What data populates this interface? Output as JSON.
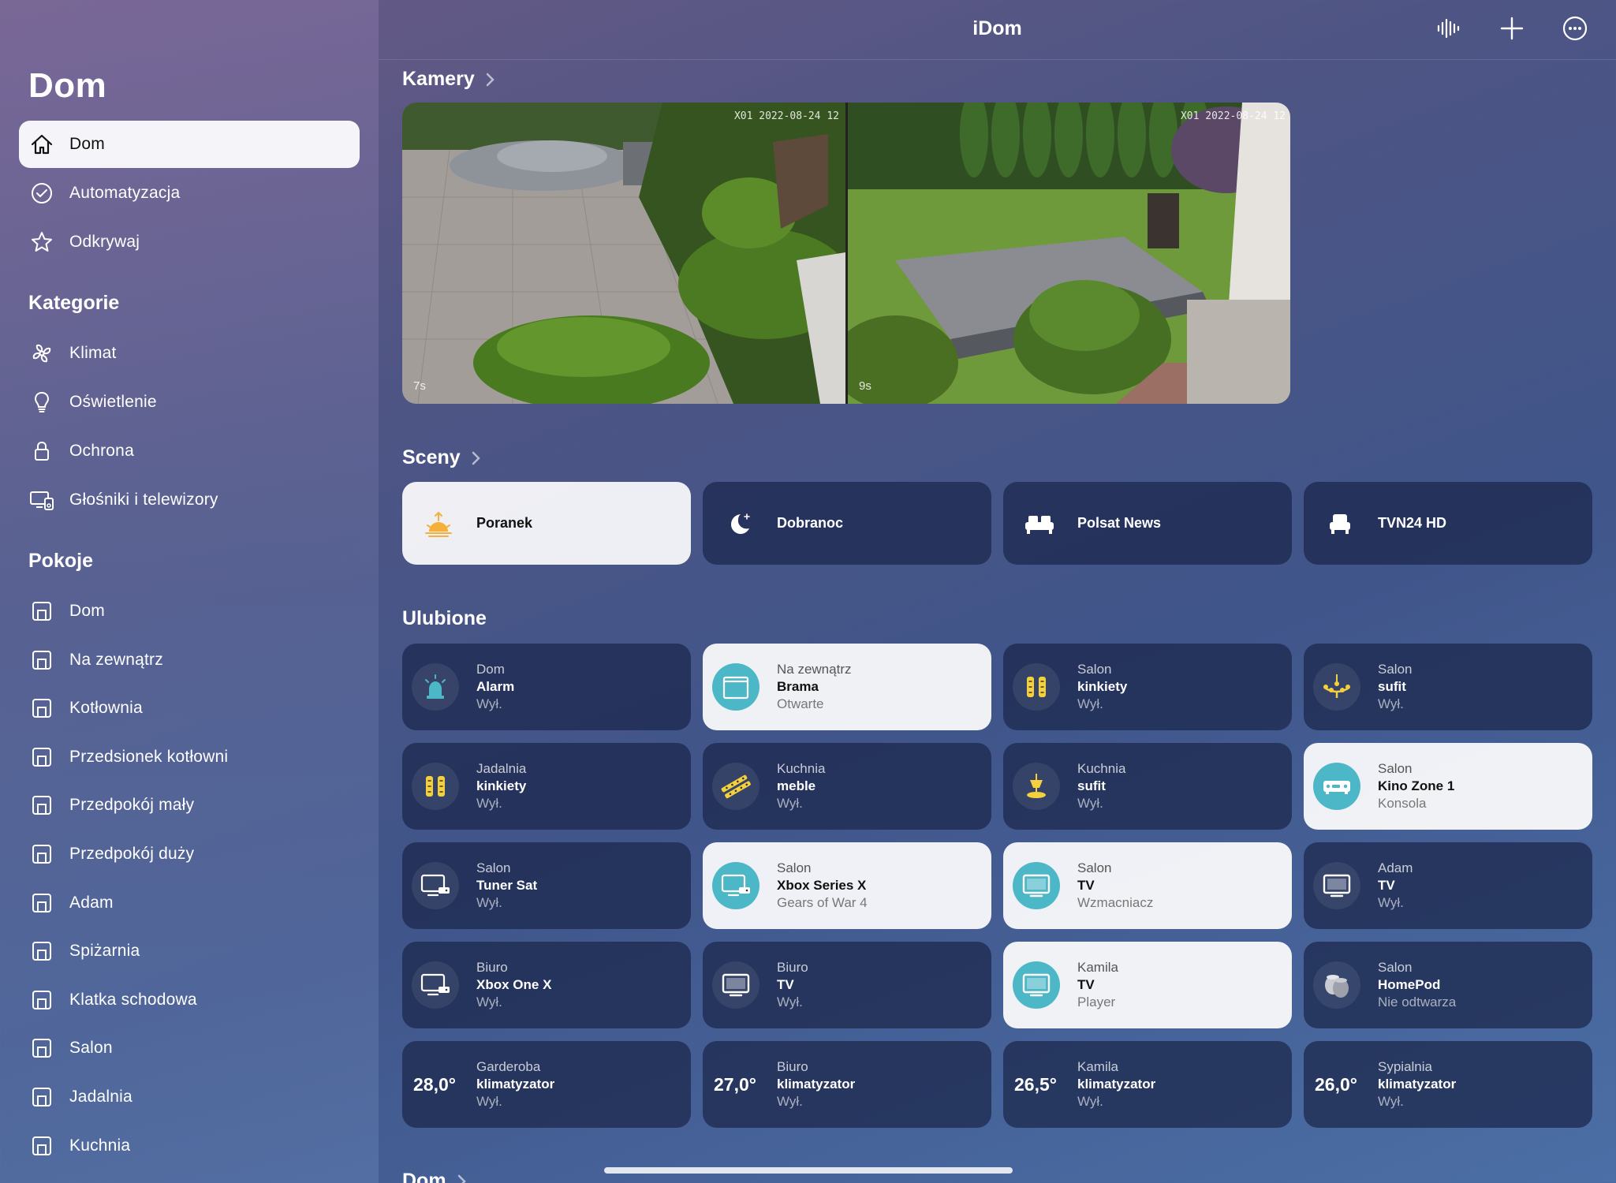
{
  "app": {
    "title": "iDom"
  },
  "toolbar": {
    "icons": [
      "waveform-icon",
      "plus-icon",
      "more-icon"
    ]
  },
  "sidebar": {
    "title": "Dom",
    "main_items": [
      {
        "label": "Dom",
        "icon": "house-icon",
        "active": true
      },
      {
        "label": "Automatyzacja",
        "icon": "clock-check-icon"
      },
      {
        "label": "Odkrywaj",
        "icon": "star-icon"
      }
    ],
    "categories_title": "Kategorie",
    "categories": [
      {
        "label": "Klimat",
        "icon": "fan-icon"
      },
      {
        "label": "Oświetlenie",
        "icon": "lightbulb-icon"
      },
      {
        "label": "Ochrona",
        "icon": "lock-icon"
      },
      {
        "label": "Głośniki i telewizory",
        "icon": "tv-speaker-icon"
      }
    ],
    "rooms_title": "Pokoje",
    "rooms": [
      {
        "label": "Dom"
      },
      {
        "label": "Na zewnątrz"
      },
      {
        "label": "Kotłownia"
      },
      {
        "label": "Przedsionek kotłowni"
      },
      {
        "label": "Przedpokój mały"
      },
      {
        "label": "Przedpokój duży"
      },
      {
        "label": "Adam"
      },
      {
        "label": "Spiżarnia"
      },
      {
        "label": "Klatka schodowa"
      },
      {
        "label": "Salon"
      },
      {
        "label": "Jadalnia"
      },
      {
        "label": "Kuchnia"
      }
    ]
  },
  "cameras": {
    "title": "Kamery",
    "feeds": [
      {
        "stamp": "X01  2022-08-24  12",
        "age": "7s"
      },
      {
        "stamp": "X01  2022-08-24  12",
        "age": "9s"
      }
    ]
  },
  "scenes": {
    "title": "Sceny",
    "items": [
      {
        "label": "Poranek",
        "icon": "sunrise-icon",
        "active": true
      },
      {
        "label": "Dobranoc",
        "icon": "moon-icon"
      },
      {
        "label": "Polsat News",
        "icon": "sofa-icon"
      },
      {
        "label": "TVN24 HD",
        "icon": "armchair-icon"
      }
    ]
  },
  "favorites": {
    "title": "Ulubione",
    "tiles": [
      {
        "room": "Dom",
        "name": "Alarm",
        "state": "Wył.",
        "icon": "alarm-icon"
      },
      {
        "room": "Na zewnątrz",
        "name": "Brama",
        "state": "Otwarte",
        "icon": "gate-icon",
        "on": true
      },
      {
        "room": "Salon",
        "name": "kinkiety",
        "state": "Wył.",
        "icon": "wall-lights-icon"
      },
      {
        "room": "Salon",
        "name": "sufit",
        "state": "Wył.",
        "icon": "chandelier-icon"
      },
      {
        "room": "Jadalnia",
        "name": "kinkiety",
        "state": "Wył.",
        "icon": "wall-lights-icon"
      },
      {
        "room": "Kuchnia",
        "name": "meble",
        "state": "Wył.",
        "icon": "light-strip-icon"
      },
      {
        "room": "Kuchnia",
        "name": "sufit",
        "state": "Wył.",
        "icon": "ceiling-lamp-icon"
      },
      {
        "room": "Salon",
        "name": "Kino Zone 1",
        "state": "Konsola",
        "icon": "receiver-icon",
        "on": true
      },
      {
        "room": "Salon",
        "name": "Tuner Sat",
        "state": "Wył.",
        "icon": "tv-box-icon"
      },
      {
        "room": "Salon",
        "name": "Xbox Series X",
        "state": "Gears of War 4",
        "icon": "tv-box-icon",
        "on": true
      },
      {
        "room": "Salon",
        "name": "TV",
        "state": "Wzmacniacz",
        "icon": "tv-icon",
        "on": true
      },
      {
        "room": "Adam",
        "name": "TV",
        "state": "Wył.",
        "icon": "tv-icon"
      },
      {
        "room": "Biuro",
        "name": "Xbox One X",
        "state": "Wył.",
        "icon": "tv-box-icon"
      },
      {
        "room": "Biuro",
        "name": "TV",
        "state": "Wył.",
        "icon": "tv-icon"
      },
      {
        "room": "Kamila",
        "name": "TV",
        "state": "Player",
        "icon": "tv-icon",
        "on": true
      },
      {
        "room": "Salon",
        "name": "HomePod",
        "state": "Nie odtwarza",
        "icon": "homepod-icon"
      },
      {
        "room": "Garderoba",
        "name": "klimatyzator",
        "state": "Wył.",
        "temp": "28,0°"
      },
      {
        "room": "Biuro",
        "name": "klimatyzator",
        "state": "Wył.",
        "temp": "27,0°"
      },
      {
        "room": "Kamila",
        "name": "klimatyzator",
        "state": "Wył.",
        "temp": "26,5°"
      },
      {
        "room": "Sypialnia",
        "name": "klimatyzator",
        "state": "Wył.",
        "temp": "26,0°"
      }
    ]
  },
  "next_section": {
    "title": "Dom"
  },
  "colors": {
    "accent": "#4cb7c6",
    "tile_dark": "#1e2a50",
    "tile_light": "#f8f8fa",
    "yellow": "#f3d03c"
  }
}
